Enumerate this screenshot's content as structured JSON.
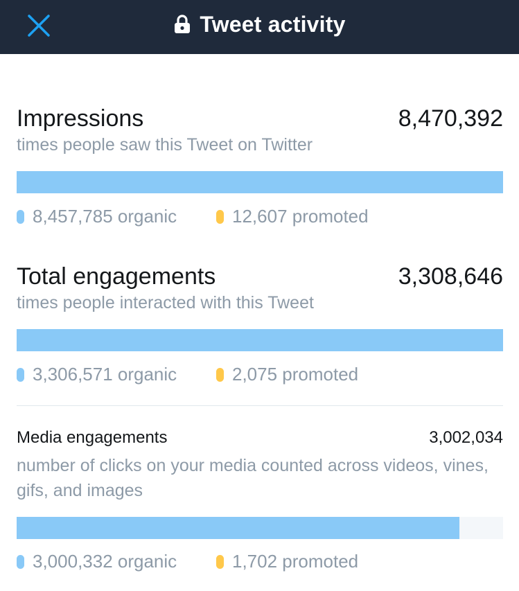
{
  "header": {
    "title": "Tweet activity",
    "close_icon": "close-x-icon",
    "lock_icon": "lock-icon"
  },
  "colors": {
    "header_bg": "#1f2a3b",
    "accent": "#1da1f2",
    "organic": "#89c9f7",
    "promoted": "#ffc84a"
  },
  "impressions": {
    "label": "Impressions",
    "value": "8,470,392",
    "description": "times people saw this Tweet on Twitter",
    "organic": "8,457,785 organic",
    "promoted": "12,607 promoted",
    "organic_fraction": 1.0
  },
  "engagements": {
    "label": "Total engagements",
    "value": "3,308,646",
    "description": "times people interacted with this Tweet",
    "organic": "3,306,571 organic",
    "promoted": "2,075 promoted",
    "organic_fraction": 1.0
  },
  "media": {
    "label": "Media engagements",
    "value": "3,002,034",
    "description": "number of clicks on your media counted across videos, vines, gifs, and images",
    "organic": "3,000,332 organic",
    "promoted": "1,702 promoted",
    "organic_fraction": 0.91
  }
}
